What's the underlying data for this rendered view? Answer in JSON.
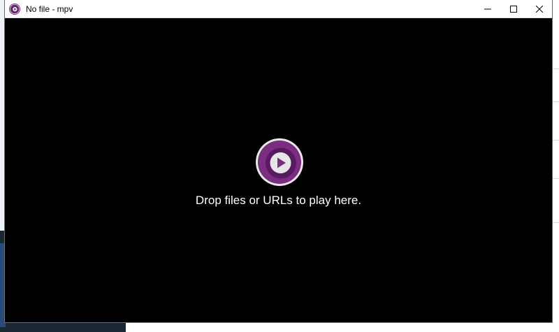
{
  "window": {
    "title": "No file - mpv",
    "app_icon": "mpv-logo-icon"
  },
  "titlebar_buttons": {
    "minimize_icon": "minimize-icon",
    "maximize_icon": "maximize-icon",
    "close_icon": "close-icon"
  },
  "main": {
    "logo_icon": "mpv-logo-icon",
    "drop_hint": "Drop files or URLs to play here."
  },
  "colors": {
    "video_background": "#000000",
    "logo_purple_outer": "#7b2d82",
    "logo_purple_inner": "#5a1a62",
    "titlebar": "#ffffff"
  }
}
